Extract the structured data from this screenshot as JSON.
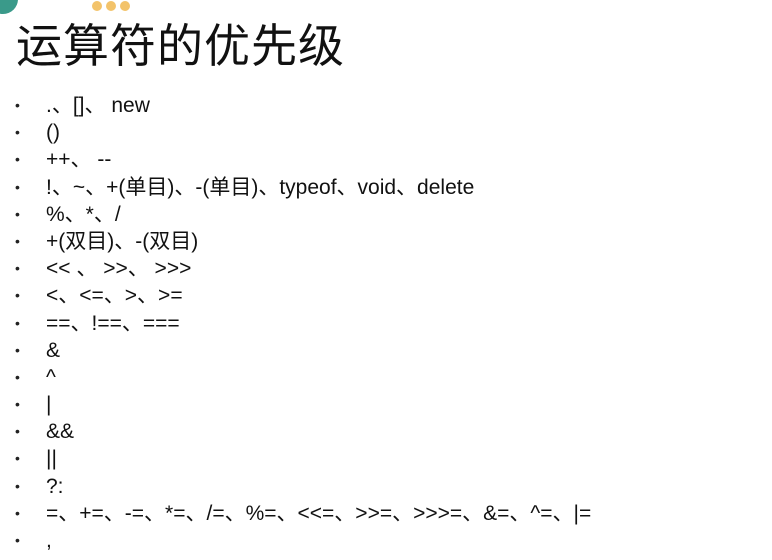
{
  "slide": {
    "title": "运算符的优先级",
    "bullet": "•",
    "items": [
      ".、[]、 new",
      "()",
      "++、 --",
      "!、~、+(单目)、-(单目)、typeof、void、delete",
      "%、*、/",
      "+(双目)、-(双目)",
      "<< 、 >>、 >>>",
      "<、<=、>、>=",
      "==、!==、===",
      "&",
      "^",
      "|",
      "&&",
      "||",
      "?:",
      "=、+=、-=、*=、/=、%=、<<=、>>=、>>>=、&=、^=、|=",
      ","
    ]
  }
}
